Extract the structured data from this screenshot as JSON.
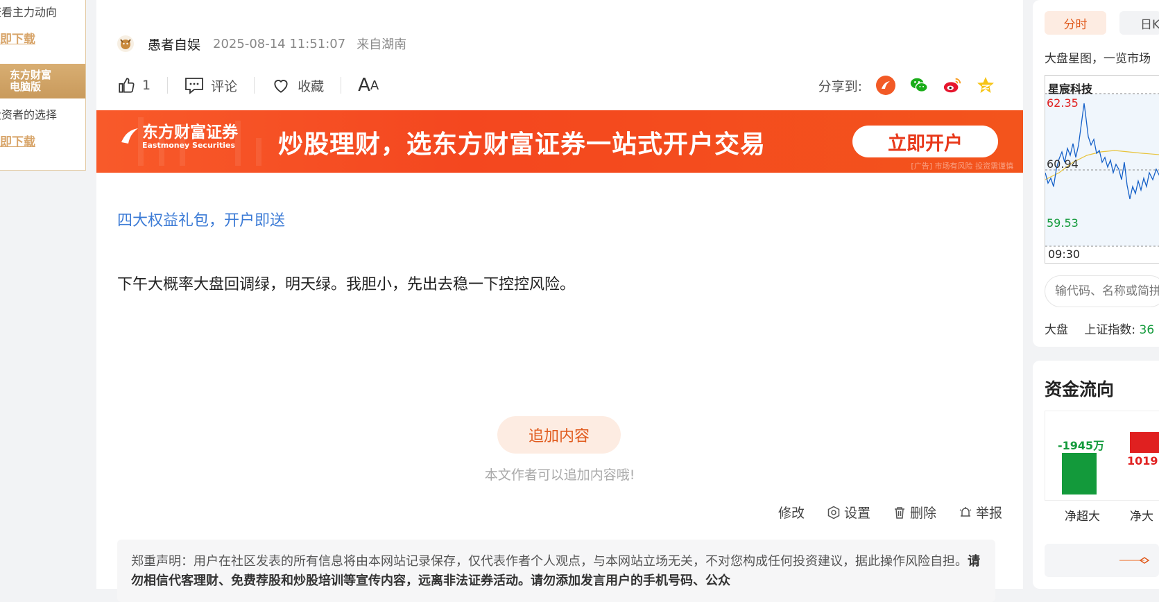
{
  "left_promo": {
    "line1": "查看主力动向",
    "download1": "立即下载",
    "badge_line1": "东方财富",
    "badge_line2": "电脑版",
    "line2": "投资者的选择",
    "download2": "立即下载"
  },
  "post": {
    "author": "愚者自娱",
    "time": "2025-08-14 11:51:07",
    "location": "来自湖南",
    "like_count": "1",
    "comment_label": "评论",
    "collect_label": "收藏",
    "font_big": "A",
    "font_small": "A",
    "share_label": "分享到:",
    "promo_link": "四大权益礼包，开户即送",
    "body": "下午大概率大盘回调绿，明天绿。我胆小，先出去稳一下控控风险。",
    "append_label": "追加内容",
    "append_hint": "本文作者可以追加内容哦!",
    "ops": {
      "edit": "修改",
      "settings": "设置",
      "delete": "删除",
      "report": "举报"
    },
    "disclaimer_normal": "郑重声明：用户在社区发表的所有信息将由本网站记录保存，仅代表作者个人观点，与本网站立场无关，不对您构成任何投资建议，据此操作风险自担。",
    "disclaimer_bold": "请勿相信代客理财、免费荐股和炒股培训等宣传内容，远离非法证券活动。请勿添加发言用户的手机号码、公众"
  },
  "banner": {
    "logo_cn": "东方财富证券",
    "logo_en": "Eastmoney Securities",
    "slogan": "炒股理财，选东方财富证券一站式开户交易",
    "button": "立即开户",
    "note": "[广告] 市场有风险 投资需谨慎"
  },
  "sidebar": {
    "tab_active": "分时",
    "tab_other": "日K",
    "desc": "大盘星图，一览市场",
    "stock_name": "星宸科技",
    "price_high": "62.35",
    "price_mid": "60.94",
    "price_low": "59.53",
    "time_start": "09:30",
    "search_placeholder": "输代码、名称或简拼",
    "index_label": "大盘",
    "index_name": "上证指数:",
    "index_value": "36",
    "flow_title": "资金流向",
    "flow_value1": "-1945万",
    "flow_value2": "1019",
    "flow_label1": "净超大",
    "flow_label2": "净大"
  },
  "colors": {
    "accent": "#e05b1e",
    "banner": "#f4471f",
    "link": "#3c7bd6",
    "up": "#e02020",
    "down": "#139a3b"
  }
}
